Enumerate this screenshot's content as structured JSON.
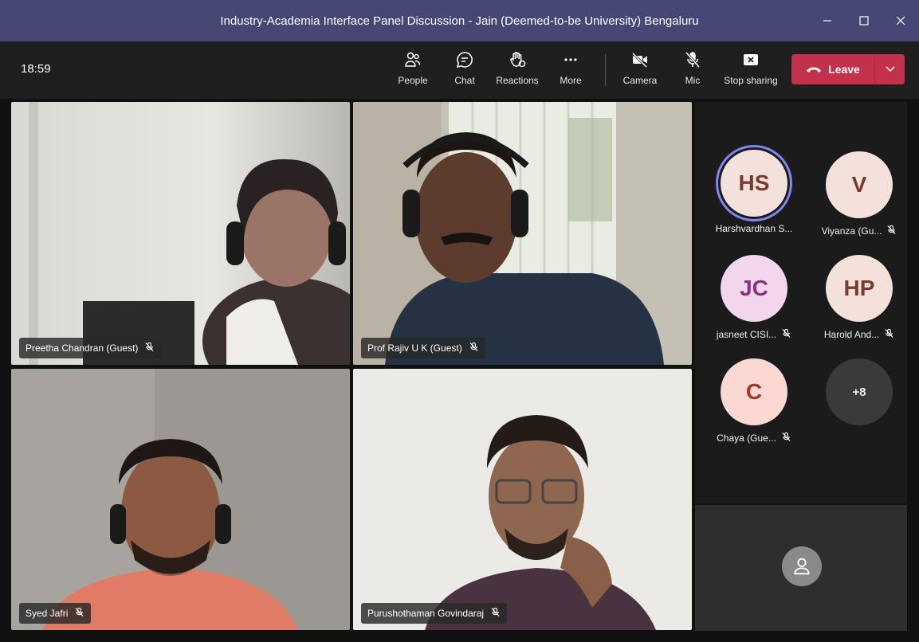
{
  "window": {
    "title": "Industry-Academia Interface Panel Discussion - Jain (Deemed-to-be University) Bengaluru",
    "controls": [
      "minimize-icon",
      "maximize-icon",
      "close-icon"
    ]
  },
  "toolbar": {
    "time": "18:59",
    "buttons": [
      {
        "label": "People",
        "icon": "people-icon"
      },
      {
        "label": "Chat",
        "icon": "chat-icon"
      },
      {
        "label": "Reactions",
        "icon": "reactions-icon"
      },
      {
        "label": "More",
        "icon": "more-icon"
      },
      {
        "label": "Camera",
        "icon": "camera-off-icon"
      },
      {
        "label": "Mic",
        "icon": "mic-off-icon"
      },
      {
        "label": "Stop sharing",
        "icon": "stop-sharing-icon"
      }
    ],
    "leave": {
      "label": "Leave",
      "color": "#c4314b"
    }
  },
  "videos": [
    {
      "name": "Preetha Chandran (Guest)",
      "muted": true
    },
    {
      "name": "Prof Rajiv U K (Guest)",
      "muted": true
    },
    {
      "name": "Syed Jafri",
      "muted": true
    },
    {
      "name": "Purushothaman Govindaraj",
      "muted": true
    }
  ],
  "participants": [
    {
      "initials": "HS",
      "name": "Harshvardhan S...",
      "muted": false,
      "bg": "#f5e1dc",
      "fg": "#7a3a2e",
      "speaking": true
    },
    {
      "initials": "V",
      "name": "Viyanza (Gu...",
      "muted": true,
      "bg": "#f5e1dc",
      "fg": "#7a3a2e"
    },
    {
      "initials": "JC",
      "name": "jasneet CISI...",
      "muted": true,
      "bg": "#f1d6ec",
      "fg": "#8a2f7b"
    },
    {
      "initials": "HP",
      "name": "Harold And...",
      "muted": true,
      "bg": "#f5e1dc",
      "fg": "#7a3a2e"
    },
    {
      "initials": "C",
      "name": "Chaya (Gue...",
      "muted": true,
      "bg": "#fbd9d2",
      "fg": "#a4372a"
    },
    {
      "overflow": "+8"
    }
  ],
  "colors": {
    "titlebar": "#464775",
    "speaking_ring": "#7f85f5",
    "toolbar": "#1f1f1f"
  }
}
